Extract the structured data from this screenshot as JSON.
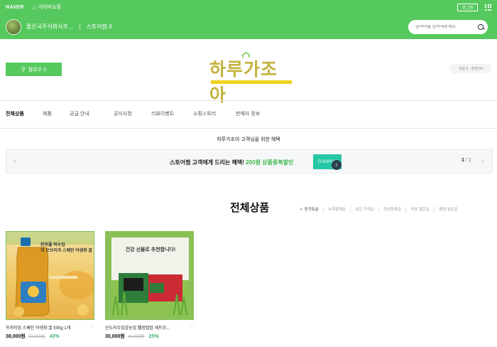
{
  "topbar": {
    "brand": "NAVER",
    "home_icon": "home-icon",
    "home_label": "네이버쇼핑",
    "login_label": "로그인",
    "apps_icon": "grid-icon"
  },
  "store": {
    "name": "좋은곡주식회사프...",
    "zzim_label": "스토어찜 0",
    "search_placeholder": "검색어를 입력해보세요",
    "search_icon": "search-icon"
  },
  "header": {
    "follow_label": "팔로우 0",
    "follow_icon": "person-plus-icon",
    "logo_text": "하루가조아",
    "visit_count": "오늘 5 · 전체 93"
  },
  "nav": {
    "items": [
      {
        "label": "전체상품"
      },
      {
        "label": "제품"
      },
      {
        "label": "공급 안내"
      },
      {
        "label": "공지사항"
      },
      {
        "label": "리뷰이벤트"
      },
      {
        "label": "쇼핑스토리"
      },
      {
        "label": "판매자 정보"
      }
    ]
  },
  "benefit": {
    "title": "하루가조아 고객님을 위한 혜택",
    "text_before": "스토어찜 고객에게 드리는 혜택!",
    "text_highlight": "200원 상품중복할인",
    "coupon_label": "COUPON",
    "page_current": "1",
    "page_total": "/ 2",
    "prev_icon": "chevron-left-icon",
    "next_icon": "chevron-right-icon"
  },
  "products": {
    "title": "전체상품",
    "sort_options": [
      {
        "label": "인기도순"
      },
      {
        "label": "누적판매순"
      },
      {
        "label": "낮은 가격순"
      },
      {
        "label": "최신등록순"
      },
      {
        "label": "리뷰 많은순"
      },
      {
        "label": "평점 높은순"
      }
    ],
    "items": [
      {
        "name": "프리미엄 스페인 야생화 꿀 500g 1개",
        "price": "38,000원",
        "original_price": "70,000원",
        "discount": "43%",
        "thumb_title": "한꺼풀 떠수입",
        "thumb_subtitle": "과 오브리과 스페인 야생화 꿀"
      },
      {
        "name": "산도라수입감농업 웰빙컵밥 세트모...",
        "price": "30,000원",
        "original_price": "40,000원",
        "discount": "25%",
        "thumb_title": "건강 선물로 추천합니다!"
      }
    ]
  },
  "colors": {
    "brand_green": "#56c95e",
    "coupon_teal": "#25c7a4",
    "discount_green": "#3cb371",
    "logo_gold": "#c3b13c",
    "logo_yellow": "#f0d21c"
  }
}
